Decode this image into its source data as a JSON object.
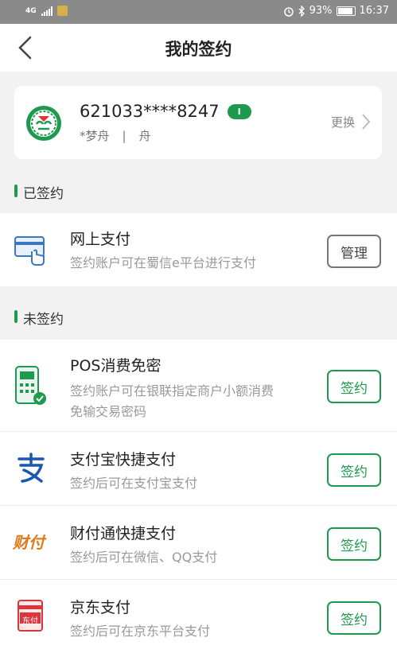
{
  "status_bar": {
    "net": "4G",
    "battery": "93%",
    "time": "16:37"
  },
  "header": {
    "title": "我的签约"
  },
  "account": {
    "number": "621033****8247",
    "badge": "I",
    "name_left": "*梦舟",
    "separator": "|",
    "name_right": "舟",
    "change_label": "更换"
  },
  "signed": {
    "title": "已签约",
    "items": [
      {
        "name": "网上支付",
        "desc": "签约账户可在蜀信e平台进行支付",
        "button": "管理"
      }
    ]
  },
  "unsigned": {
    "title": "未签约",
    "items": [
      {
        "name": "POS消费免密",
        "desc_line1": "签约账户可在银联指定商户小额消费",
        "desc_line2": "免输交易密码",
        "button": "签约"
      },
      {
        "name": "支付宝快捷支付",
        "desc": "签约后可在支付宝支付",
        "button": "签约"
      },
      {
        "name": "财付通快捷支付",
        "desc": "签约后可在微信、QQ支付",
        "button": "签约",
        "icon_text": "财付"
      },
      {
        "name": "京东支付",
        "desc": "签约后可在京东平台支付",
        "button": "签约",
        "icon_text": "东付"
      }
    ]
  },
  "colors": {
    "accent": "#1e9a4e",
    "statusbar": "#8a8a8a",
    "background": "#f2f2f2"
  }
}
